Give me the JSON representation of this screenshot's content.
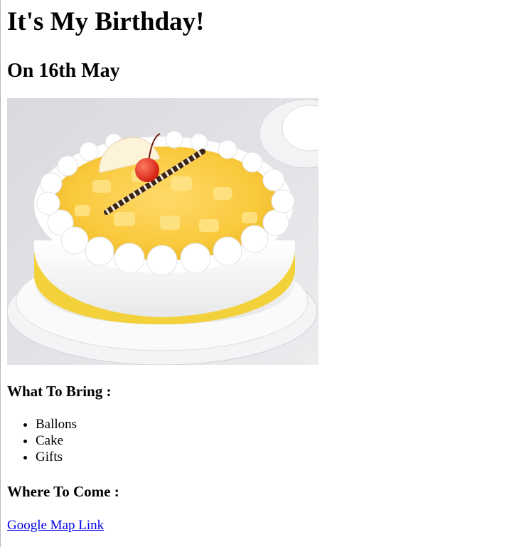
{
  "heading": {
    "title": "It's My Birthday!",
    "date": "On 16th May"
  },
  "image": {
    "subject": "cake"
  },
  "bring": {
    "heading": "What To Bring :",
    "items": [
      "Ballons",
      "Cake",
      "Gifts"
    ]
  },
  "come": {
    "heading": "Where To Come :",
    "link_text": "Google Map Link"
  }
}
